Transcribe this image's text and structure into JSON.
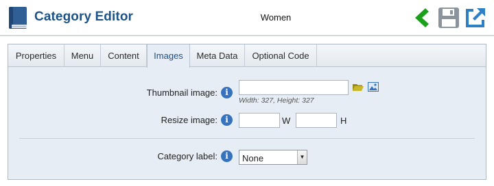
{
  "header": {
    "title": "Category Editor",
    "record_name": "Women",
    "icons": [
      "book-icon",
      "back-arrow-icon",
      "save-icon",
      "external-link-icon"
    ],
    "colors": {
      "title": "#1d5287",
      "back_arrow": "#1aa01a",
      "save": "#8b949d",
      "external": "#2f7fc4"
    }
  },
  "tabs": [
    {
      "label": "Properties"
    },
    {
      "label": "Menu"
    },
    {
      "label": "Content"
    },
    {
      "label": "Images",
      "active": true
    },
    {
      "label": "Meta Data"
    },
    {
      "label": "Optional Code"
    }
  ],
  "form": {
    "thumbnail": {
      "label": "Thumbnail image:",
      "value": "",
      "hint": "Width: 327, Height: 327"
    },
    "resize": {
      "label": "Resize image:",
      "width_value": "",
      "height_value": "",
      "width_unit": "W",
      "height_unit": "H"
    },
    "category_label": {
      "label": "Category label:",
      "selected": "None"
    },
    "info_glyph": "i"
  }
}
